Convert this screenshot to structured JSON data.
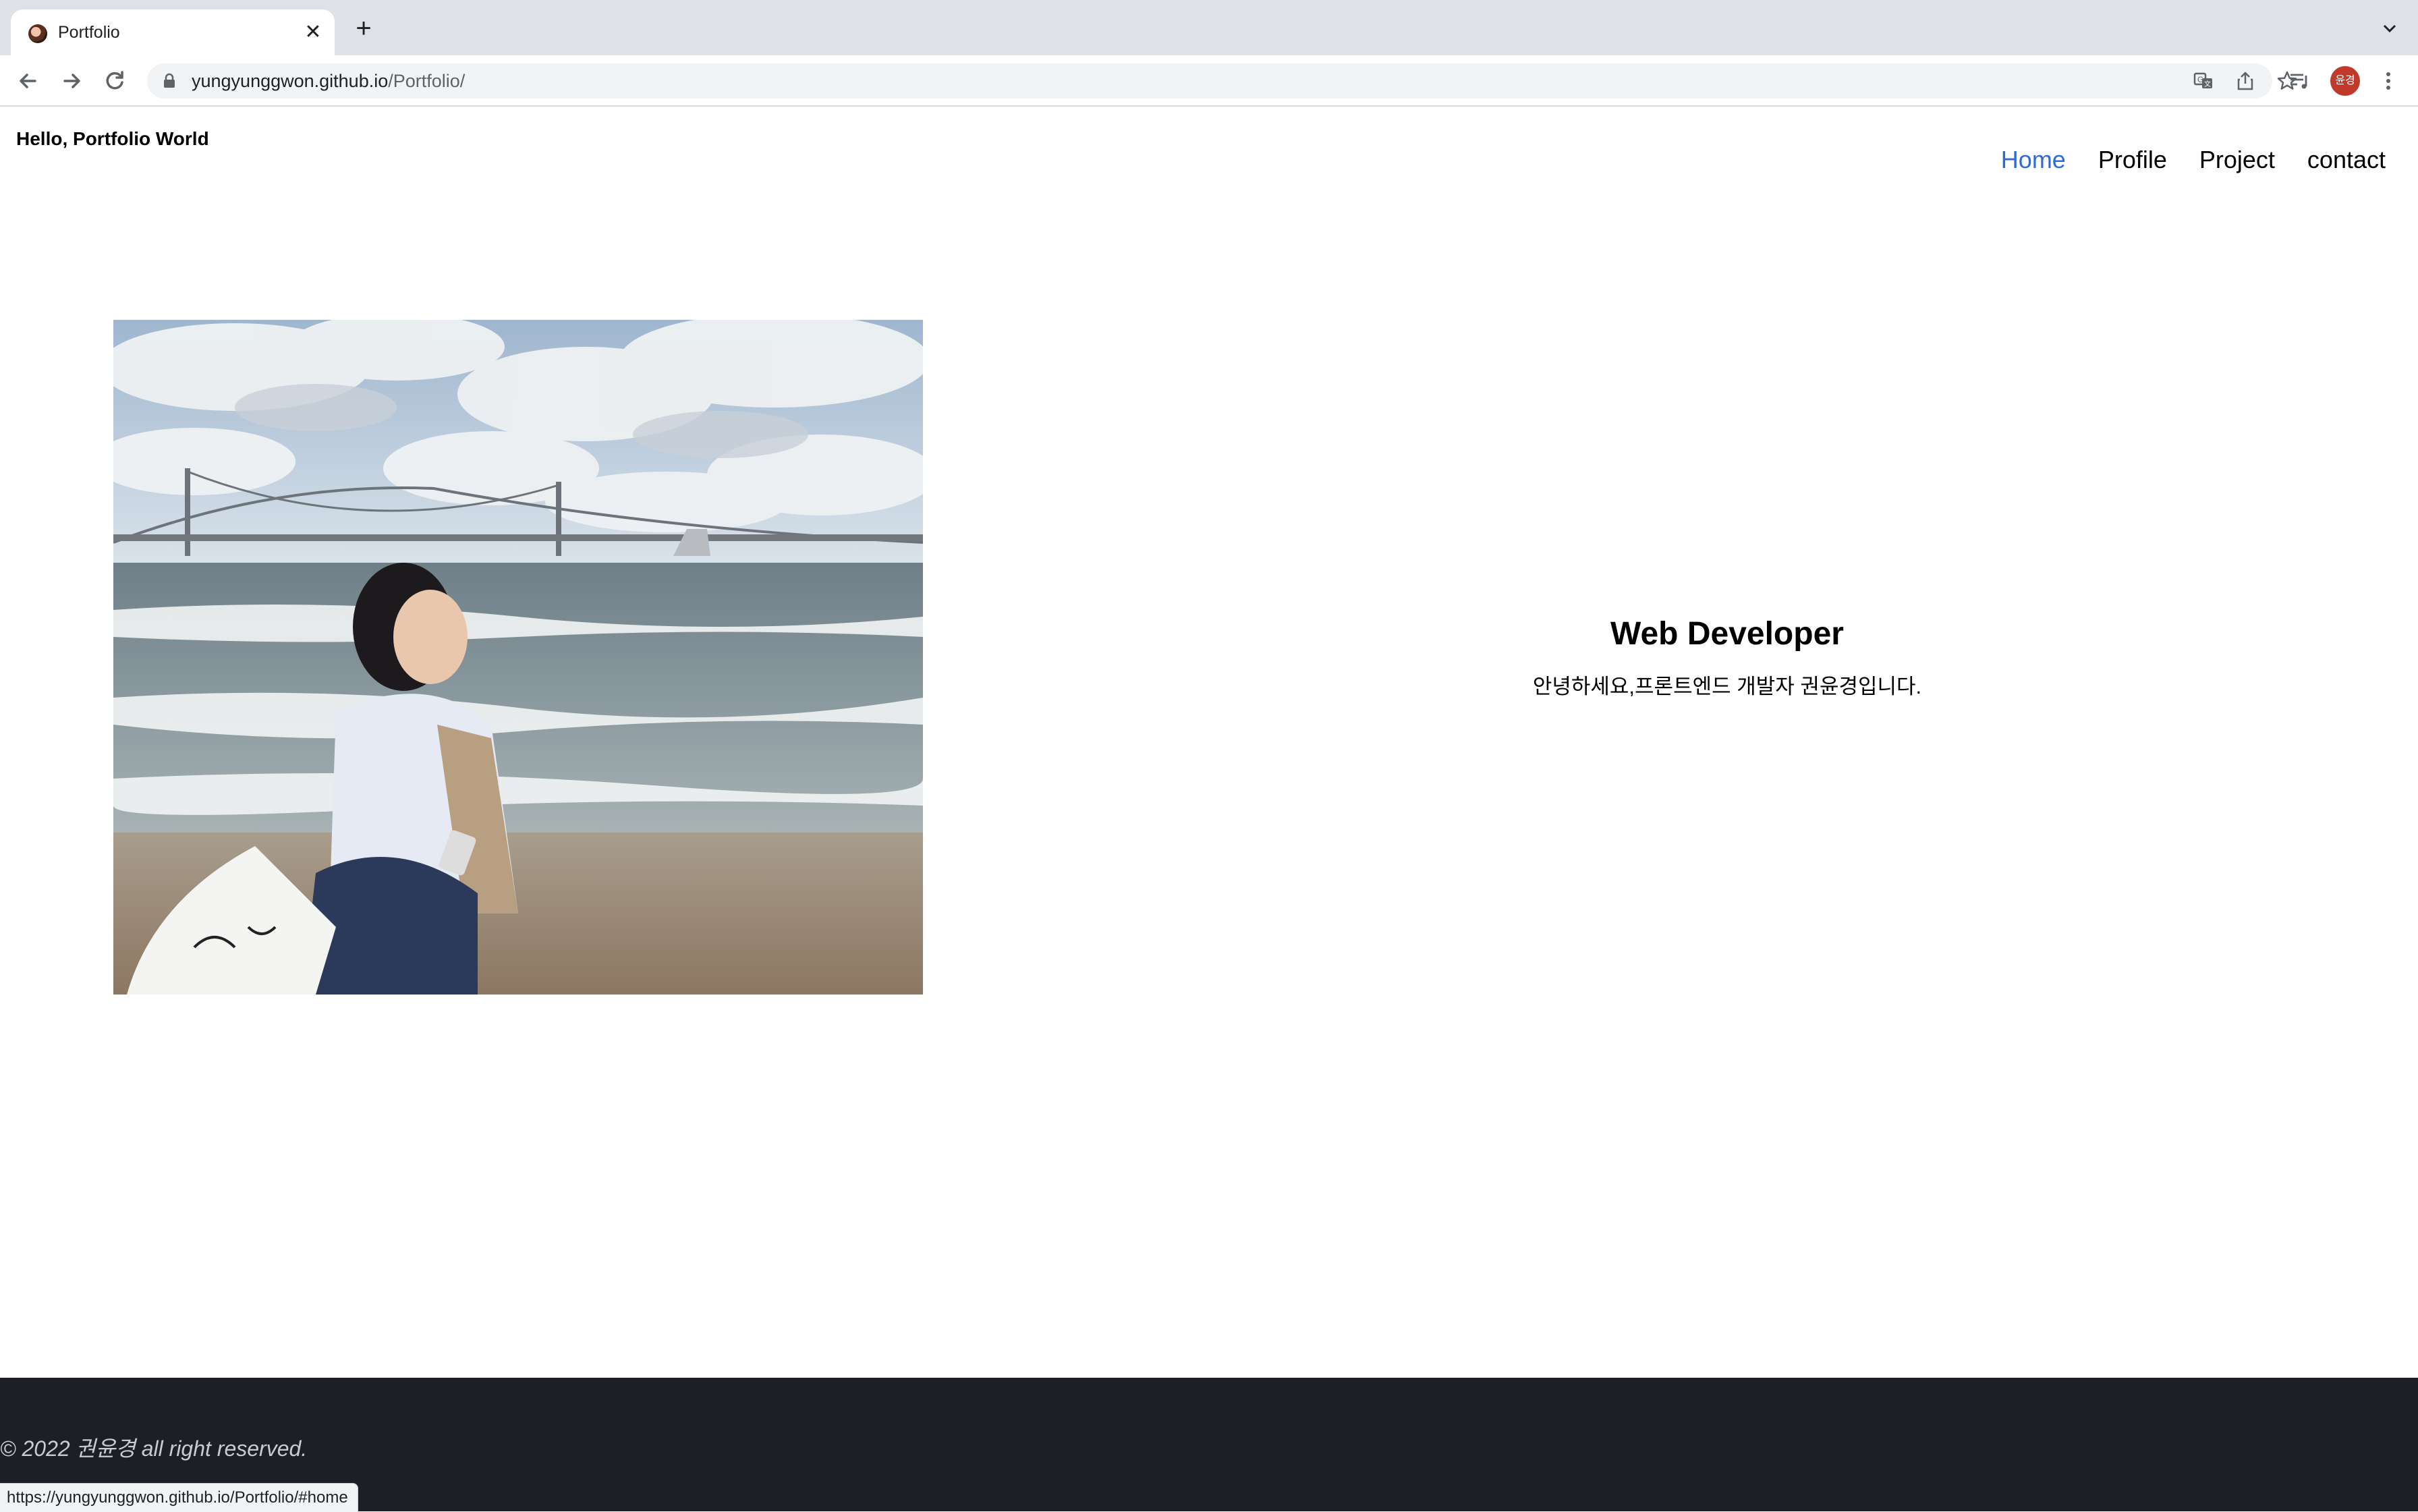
{
  "browser": {
    "tab_title": "Portfolio",
    "url_host": "yungyunggwon.github.io",
    "url_path": "/Portfolio/",
    "profile_initials": "윤경",
    "status_url": "https://yungyunggwon.github.io/Portfolio/#home"
  },
  "site": {
    "brand": "Hello, Portfolio World",
    "nav": [
      {
        "label": "Home",
        "active": true
      },
      {
        "label": "Profile",
        "active": false
      },
      {
        "label": "Project",
        "active": false
      },
      {
        "label": "contact",
        "active": false
      }
    ],
    "nav_active_color": "#2f6ad9"
  },
  "hero": {
    "title": "Web Developer",
    "description": "안녕하세요,프론트엔드 개발자 권윤경입니다."
  },
  "footer": {
    "copyright": "© 2022 권윤경 all right reserved.",
    "background": "#1c1f26"
  },
  "icons": [
    "back-icon",
    "forward-icon",
    "reload-icon",
    "lock-icon",
    "translate-icon",
    "share-icon",
    "star-icon",
    "reading-list-icon",
    "menu-icon",
    "new-tab-icon",
    "tab-search-icon",
    "close-icon"
  ]
}
